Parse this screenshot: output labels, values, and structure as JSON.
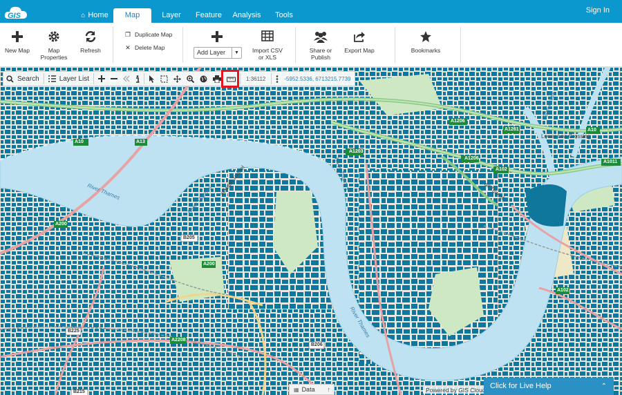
{
  "app": {
    "logo_text": "GIS",
    "signin": "Sign In"
  },
  "nav": {
    "tabs": [
      {
        "label": "Home",
        "icon": "home-icon"
      },
      {
        "label": "Map"
      },
      {
        "label": "Layer"
      },
      {
        "label": "Feature"
      },
      {
        "label": "Analysis"
      },
      {
        "label": "Tools"
      }
    ],
    "active": "Map"
  },
  "ribbon": {
    "new_map": "New Map",
    "map_properties_1": "Map",
    "map_properties_2": "Properties",
    "refresh": "Refresh",
    "duplicate_map": "Duplicate Map",
    "delete_map": "Delete Map",
    "add_layer": "Add Layer",
    "import_1": "Import CSV",
    "import_2": "or XLS",
    "share_1": "Share or",
    "share_2": "Publish",
    "export_map": "Export Map",
    "bookmarks": "Bookmarks"
  },
  "toolbar": {
    "search": "Search",
    "layer_list": "Layer List",
    "scale": "1:36112",
    "coords": "-5952.5336, 6713215.7739"
  },
  "map_labels": {
    "river1": "River Thames",
    "river2": "River Thames",
    "river3": "River Thames",
    "river4": "River Thames",
    "tunnel1": "ackwall Tunnel",
    "tunnel2": "all Tunnel",
    "bow_creek": "Bow Creek",
    "lower_lea": "Lower Lea Crossing",
    "a1203": "A1203",
    "a1206": "A1206",
    "a1261": "A1261",
    "a102a": "A102",
    "a102b": "A102",
    "a1011": "A1011",
    "a13": "A13",
    "a105": "A10",
    "a10": "A10",
    "a200": "A200",
    "b205": "B205",
    "b206": "B206",
    "b215": "B215",
    "b225": "B225",
    "a2208": "A2208"
  },
  "bottom": {
    "data": "Data",
    "powered": "Powered by GIS Cloud",
    "live_help": "Click for Live Help"
  },
  "colors": {
    "brand": "#0a98cf",
    "building": "#10779c",
    "water": "#bfe2f2",
    "highlight": "#e8141c"
  }
}
